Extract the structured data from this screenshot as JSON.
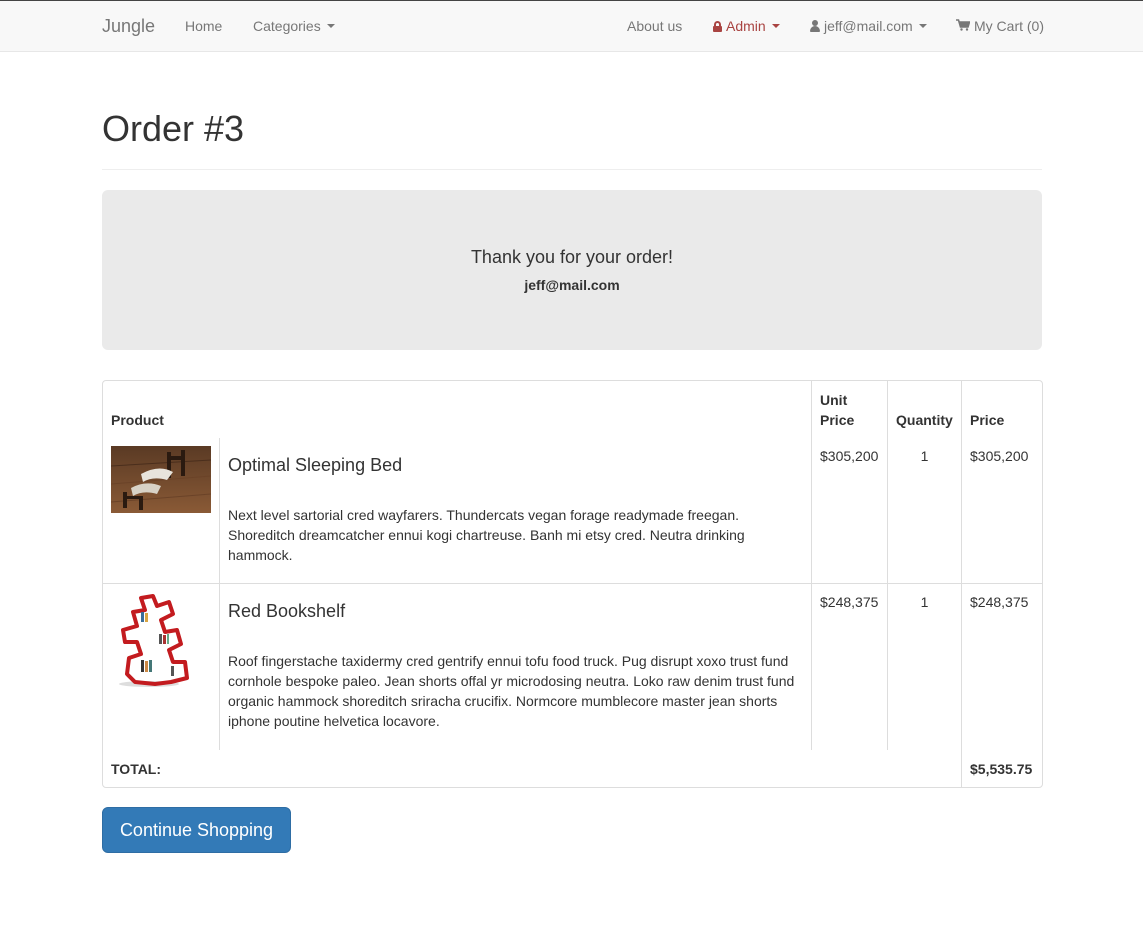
{
  "navbar": {
    "brand": "Jungle",
    "home": "Home",
    "categories": "Categories",
    "about": "About us",
    "admin": "Admin",
    "user_email": "jeff@mail.com",
    "cart": "My Cart (0)"
  },
  "page": {
    "title": "Order #3"
  },
  "confirmation": {
    "message": "Thank you for your order!",
    "email": "jeff@mail.com"
  },
  "table": {
    "headers": {
      "product": "Product",
      "unit_price": "Unit Price",
      "quantity": "Quantity",
      "price": "Price"
    },
    "items": [
      {
        "name": "Optimal Sleeping Bed",
        "description": "Next level sartorial cred wayfarers. Thundercats vegan forage readymade freegan. Shoreditch dreamcatcher ennui kogi chartreuse. Banh mi etsy cred. Neutra drinking hammock.",
        "unit_price": "$305,200",
        "quantity": "1",
        "price": "$305,200",
        "image_icon": "bed-photo"
      },
      {
        "name": "Red Bookshelf",
        "description": "Roof fingerstache taxidermy cred gentrify ennui tofu food truck. Pug disrupt xoxo trust fund cornhole bespoke paleo. Jean shorts offal yr microdosing neutra. Loko raw denim trust fund organic hammock shoreditch sriracha crucifix. Normcore mumblecore master jean shorts iphone poutine helvetica locavore.",
        "unit_price": "$248,375",
        "quantity": "1",
        "price": "$248,375",
        "image_icon": "bookshelf-photo"
      }
    ],
    "total_label": "TOTAL:",
    "total_value": "$5,535.75"
  },
  "actions": {
    "continue_shopping": "Continue Shopping"
  },
  "colors": {
    "primary": "#337ab7",
    "admin": "#a94442",
    "navbar_bg": "#f8f8f8",
    "jumbotron_bg": "#eaeaea"
  }
}
